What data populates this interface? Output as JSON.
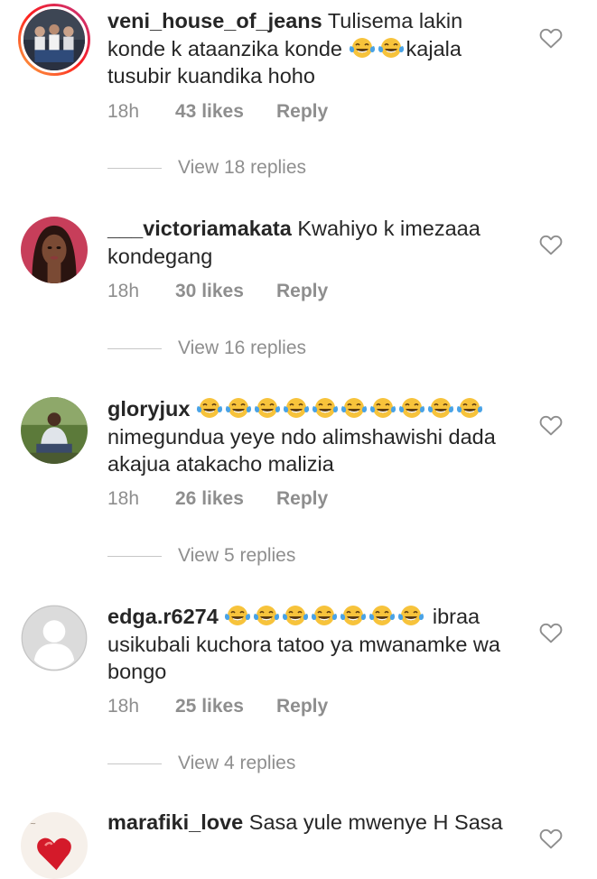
{
  "comments": [
    {
      "username": "veni_house_of_jeans",
      "text_parts": [
        "Tulisema lakin konde k ataanzika konde ",
        "",
        "",
        "kajala tusubir kuandika hoho"
      ],
      "time": "18h",
      "likes": "43 likes",
      "reply": "Reply",
      "view_replies": "View 18 replies",
      "avatar_icon": "profile-photo-group-icon",
      "has_story_ring": true
    },
    {
      "username": "___victoriamakata",
      "text": "Kwahiyo k imezaaa kondegang",
      "time": "18h",
      "likes": "30 likes",
      "reply": "Reply",
      "view_replies": "View 16 replies",
      "avatar_icon": "profile-photo-woman-icon"
    },
    {
      "username": "gloryjux",
      "emoji_count": 10,
      "text": "nimegundua yeye ndo alimshawishi dada akajua atakacho malizia",
      "time": "18h",
      "likes": "26 likes",
      "reply": "Reply",
      "view_replies": "View 5 replies",
      "avatar_icon": "profile-photo-man-icon"
    },
    {
      "username": "edga.r6274",
      "emoji_count": 7,
      "text": "ibraa usikubali kuchora tatoo ya mwanamke wa bongo",
      "time": "18h",
      "likes": "25 likes",
      "reply": "Reply",
      "view_replies": "View 4 replies",
      "avatar_icon": "default-avatar-icon"
    },
    {
      "username": "marafiki_love",
      "text": "Sasa yule mwenye H Sasa",
      "avatar_icon": "profile-photo-heart-icon"
    }
  ],
  "colors": {
    "text": "#262626",
    "secondary": "#8e8e8e",
    "divider": "#c7c7c7",
    "story_ring_start": "#fcb045",
    "story_ring_end": "#c13584"
  },
  "icons": {
    "like": "heart-outline-icon",
    "emoji": "face-with-tears-of-joy-icon"
  }
}
